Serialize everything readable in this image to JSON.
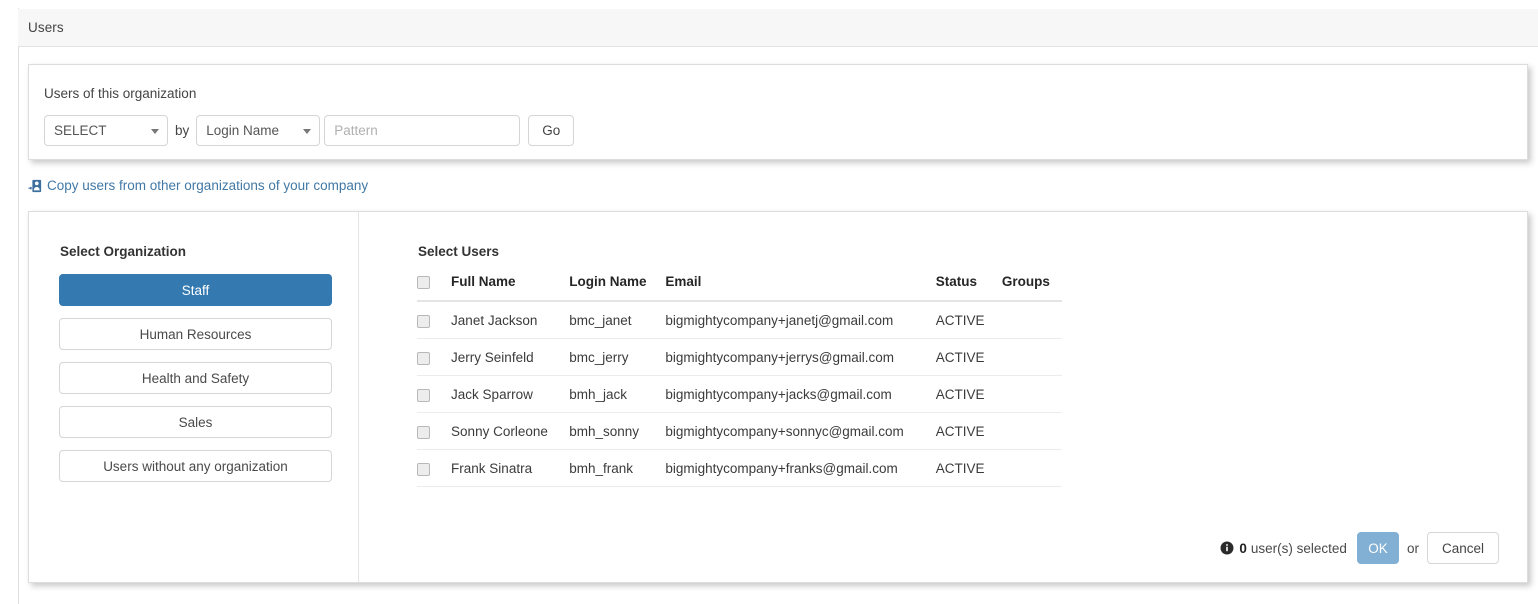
{
  "header": {
    "title": "Users"
  },
  "search_panel": {
    "label": "Users of this organization",
    "mode_select": {
      "value": "SELECT",
      "icon": "chevron-down-icon"
    },
    "by_word": "by",
    "field_select": {
      "value": "Login Name",
      "icon": "chevron-down-icon"
    },
    "pattern_input": {
      "value": "",
      "placeholder": "Pattern"
    },
    "go_label": "Go"
  },
  "copy_link": {
    "icon": "user-import-icon",
    "text": "Copy users from other organizations of your company",
    "color": "#4178a5"
  },
  "select_panel": {
    "organization": {
      "title": "Select Organization",
      "active_index": 0,
      "items": [
        {
          "label": "Staff"
        },
        {
          "label": "Human Resources"
        },
        {
          "label": "Health and Safety"
        },
        {
          "label": "Sales"
        },
        {
          "label": "Users without any organization"
        }
      ]
    },
    "users": {
      "title": "Select Users",
      "select_all_checkbox": {
        "checked": false
      },
      "columns": [
        "Full Name",
        "Login Name",
        "Email",
        "Status",
        "Groups"
      ],
      "rows": [
        {
          "checked": false,
          "full_name": "Janet Jackson",
          "login_name": "bmc_janet",
          "email": "bigmightycompany+janetj@gmail.com",
          "status": "ACTIVE",
          "groups": ""
        },
        {
          "checked": false,
          "full_name": "Jerry Seinfeld",
          "login_name": "bmc_jerry",
          "email": "bigmightycompany+jerrys@gmail.com",
          "status": "ACTIVE",
          "groups": ""
        },
        {
          "checked": false,
          "full_name": "Jack Sparrow",
          "login_name": "bmh_jack",
          "email": "bigmightycompany+jacks@gmail.com",
          "status": "ACTIVE",
          "groups": ""
        },
        {
          "checked": false,
          "full_name": "Sonny Corleone",
          "login_name": "bmh_sonny",
          "email": "bigmightycompany+sonnyc@gmail.com",
          "status": "ACTIVE",
          "groups": ""
        },
        {
          "checked": false,
          "full_name": "Frank Sinatra",
          "login_name": "bmh_frank",
          "email": "bigmightycompany+franks@gmail.com",
          "status": "ACTIVE",
          "groups": ""
        }
      ]
    },
    "footer": {
      "info_icon": "info-circle-icon",
      "count": "0",
      "count_suffix": "user(s) selected",
      "ok_label": "OK",
      "or_word": "or",
      "cancel_label": "Cancel"
    }
  },
  "colors": {
    "accent_blue": "#3479b0",
    "link_blue": "#4178a5",
    "ok_disabled_blue": "#82b0d4",
    "band_bg": "#f7f7f7"
  }
}
